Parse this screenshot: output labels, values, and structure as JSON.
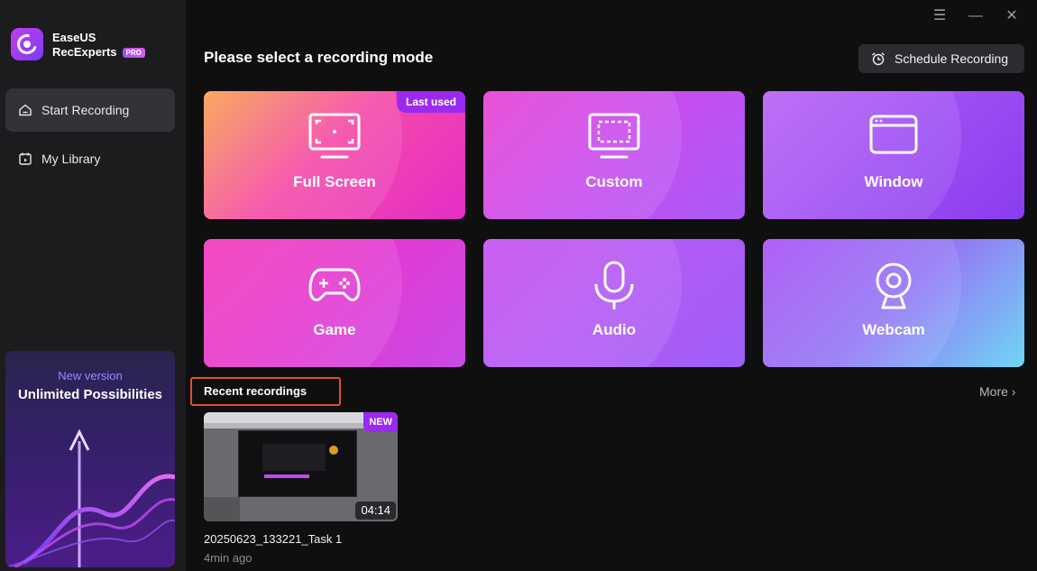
{
  "app": {
    "brand_line1": "EaseUS",
    "brand_line2": "RecExperts",
    "pro_badge": "PRO"
  },
  "sidebar": {
    "items": [
      {
        "label": "Start Recording",
        "icon": "home-icon",
        "active": true
      },
      {
        "label": "My Library",
        "icon": "library-icon",
        "active": false
      }
    ],
    "promo": {
      "subtitle": "New version",
      "title": "Unlimited Possibilities"
    }
  },
  "window_controls": [
    "menu-icon",
    "minimize-icon",
    "close-icon"
  ],
  "main": {
    "heading": "Please select a recording mode",
    "schedule_label": "Schedule Recording",
    "modes": [
      {
        "label": "Full Screen",
        "icon": "fullscreen-icon",
        "badge": "Last used"
      },
      {
        "label": "Custom",
        "icon": "custom-region-icon"
      },
      {
        "label": "Window",
        "icon": "window-icon"
      },
      {
        "label": "Game",
        "icon": "gamepad-icon"
      },
      {
        "label": "Audio",
        "icon": "microphone-icon"
      },
      {
        "label": "Webcam",
        "icon": "webcam-icon"
      }
    ],
    "recent": {
      "title": "Recent recordings",
      "more_label": "More",
      "items": [
        {
          "badge": "NEW",
          "duration": "04:14",
          "name": "20250623_133221_Task 1",
          "time": "4min ago"
        }
      ]
    }
  },
  "colors": {
    "accent_red": "#e84b34",
    "badge_purple": "#9b2af0"
  }
}
